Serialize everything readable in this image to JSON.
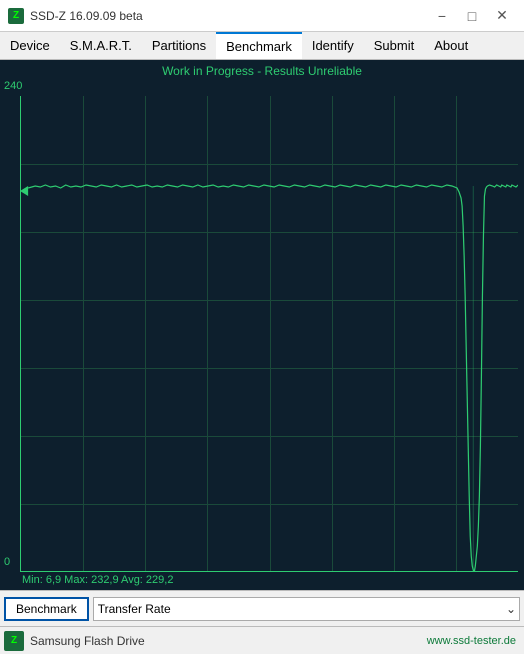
{
  "titleBar": {
    "icon": "Z",
    "title": "SSD-Z 16.09.09 beta",
    "minBtn": "−",
    "maxBtn": "□",
    "closeBtn": "✕"
  },
  "menuBar": {
    "items": [
      {
        "label": "Device",
        "active": false
      },
      {
        "label": "S.M.A.R.T.",
        "active": false
      },
      {
        "label": "Partitions",
        "active": false
      },
      {
        "label": "Benchmark",
        "active": true
      },
      {
        "label": "Identify",
        "active": false
      },
      {
        "label": "Submit",
        "active": false
      },
      {
        "label": "About",
        "active": false
      }
    ]
  },
  "chart": {
    "title": "Work in Progress - Results Unreliable",
    "yLabelTop": "240",
    "yLabelBottom": "0",
    "stats": "Min: 6,9  Max: 232,9  Avg: 229,2"
  },
  "toolbar": {
    "benchmarkBtn": "Benchmark",
    "dropdownValue": "Transfer Rate",
    "dropdownArrow": "⌄"
  },
  "statusBar": {
    "iconLabel": "Z",
    "deviceName": "Samsung Flash Drive",
    "url": "www.ssd-tester.de"
  }
}
